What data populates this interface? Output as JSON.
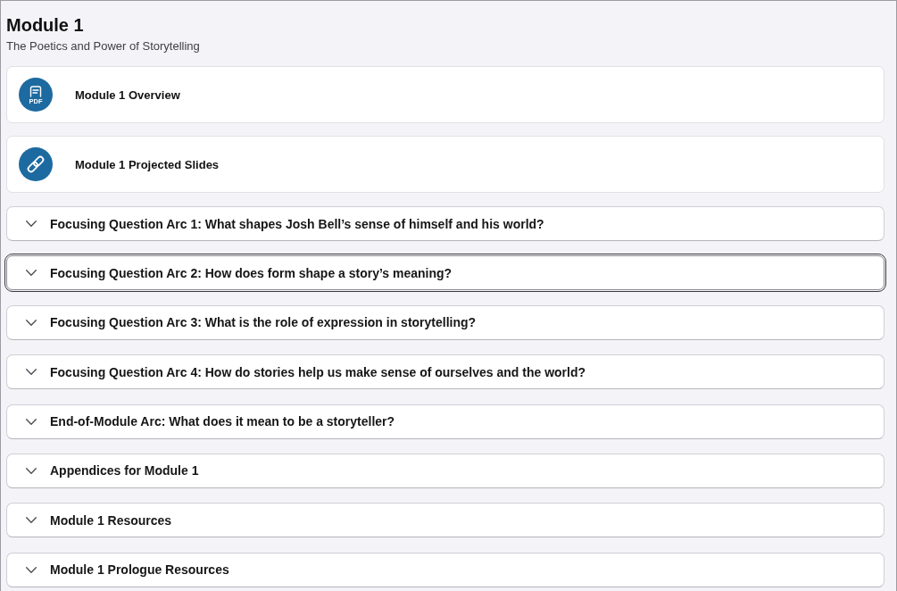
{
  "module": {
    "title": "Module 1",
    "subtitle": "The Poetics and Power of Storytelling"
  },
  "resources": [
    {
      "kind": "pdf",
      "icon_text": "PDF",
      "label": "Module 1 Overview"
    },
    {
      "kind": "link",
      "label": "Module 1 Projected Slides"
    }
  ],
  "accordions": [
    {
      "label": "Focusing Question Arc 1: What shapes Josh Bell’s sense of himself and his world?",
      "expanded": false,
      "focused": false
    },
    {
      "label": "Focusing Question Arc 2: How does form shape a story’s meaning?",
      "expanded": false,
      "focused": true
    },
    {
      "label": "Focusing Question Arc 3: What is the role of expression in storytelling?",
      "expanded": false,
      "focused": false
    },
    {
      "label": "Focusing Question Arc 4: How do stories help us make sense of ourselves and the world?",
      "expanded": false,
      "focused": false
    },
    {
      "label": "End-of-Module Arc: What does it mean to be a storyteller?",
      "expanded": false,
      "focused": false
    },
    {
      "label": "Appendices for Module 1",
      "expanded": false,
      "focused": false
    },
    {
      "label": "Module 1 Resources",
      "expanded": false,
      "focused": false
    },
    {
      "label": "Module 1 Prologue Resources",
      "expanded": false,
      "focused": false
    }
  ]
}
